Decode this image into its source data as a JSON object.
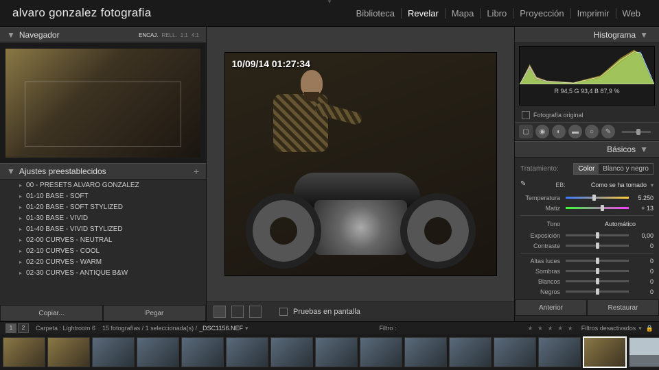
{
  "identity": "alvaro gonzalez fotografia",
  "modules": [
    "Biblioteca",
    "Revelar",
    "Mapa",
    "Libro",
    "Proyección",
    "Imprimir",
    "Web"
  ],
  "active_module": 1,
  "left": {
    "nav_title": "Navegador",
    "nav_opts": [
      "ENCAJ.",
      "RELL.",
      "1:1",
      "4:1"
    ],
    "nav_sel": 0,
    "presets_title": "Ajustes preestablecidos",
    "presets": [
      "00 - PRESETS ALVARO GONZALEZ",
      "01-10 BASE - SOFT",
      "01-20 BASE - SOFT STYLIZED",
      "01-30 BASE - VIVID",
      "01-40 BASE - VIVID STYLIZED",
      "02-00 CURVES - NEUTRAL",
      "02-10 CURVES - COOL",
      "02-20 CURVES - WARM",
      "02-30 CURVES - ANTIQUE B&W"
    ],
    "copy": "Copiar...",
    "paste": "Pegar"
  },
  "center": {
    "timestamp": "10/09/14 01:27:34",
    "softproof": "Pruebas en pantalla"
  },
  "right": {
    "hist_title": "Histograma",
    "rgb": "R  94,5   G  93,4   B  87,9 %",
    "orig": "Fotografía original",
    "basics_title": "Básicos",
    "treatment_label": "Tratamiento:",
    "color": "Color",
    "bw": "Blanco y negro",
    "wb_label": "EB:",
    "wb_value": "Como se ha tomado",
    "temp_label": "Temperatura",
    "temp_value": "5.250",
    "tint_label": "Matiz",
    "tint_value": "+ 13",
    "tono": "Tono",
    "auto": "Automático",
    "sliders": [
      {
        "n": "Exposición",
        "v": "0,00"
      },
      {
        "n": "Contraste",
        "v": "0"
      }
    ],
    "sliders2": [
      {
        "n": "Altas luces",
        "v": "0"
      },
      {
        "n": "Sombras",
        "v": "0"
      },
      {
        "n": "Blancos",
        "v": "0"
      },
      {
        "n": "Negros",
        "v": "0"
      }
    ],
    "prev": "Anterior",
    "reset": "Restaurar"
  },
  "info": {
    "pages": [
      "1",
      "2"
    ],
    "folder": "Carpeta : Lightroom 6",
    "count": "15 fotografías / 1 seleccionada(s) /",
    "file": "_DSC1156.NEF",
    "filter": "Filtro :",
    "filters_off": "Filtros desactivados"
  }
}
